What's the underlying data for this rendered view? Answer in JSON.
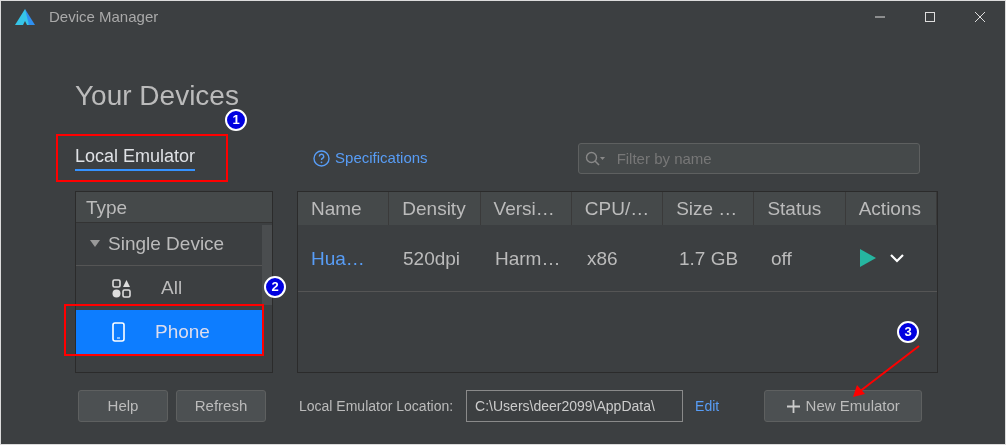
{
  "window": {
    "title": "Device Manager"
  },
  "heading": "Your Devices",
  "tabs": [
    {
      "label": "Local Emulator",
      "selected": true
    }
  ],
  "specifications_link": "Specifications",
  "search": {
    "placeholder": "Filter by name"
  },
  "type_panel": {
    "header": "Type",
    "groups": [
      {
        "label": "Single Device",
        "expanded": true,
        "children": [
          {
            "label": "All",
            "kind": "all",
            "selected": false
          },
          {
            "label": "Phone",
            "kind": "phone",
            "selected": true
          }
        ]
      }
    ]
  },
  "table": {
    "columns": [
      "Name",
      "Density",
      "Versi…",
      "CPU/…",
      "Size …",
      "Status",
      "Actions"
    ],
    "rows": [
      {
        "cells": [
          "Hua…",
          "520dpi",
          "Harm…",
          "x86",
          "1.7 GB",
          "off"
        ]
      }
    ]
  },
  "buttons": [
    {
      "label": "Help"
    },
    {
      "label": "Refresh"
    }
  ],
  "location": {
    "label": "Local Emulator Location:",
    "value": "C:\\Users\\deer2099\\AppData\\",
    "edit_link": "Edit"
  },
  "new_emulator_button": "New Emulator",
  "annotations": [
    {
      "label": "1",
      "kind": "tabs"
    },
    {
      "label": "2",
      "kind": "type"
    },
    {
      "label": "3",
      "kind": "new"
    }
  ]
}
